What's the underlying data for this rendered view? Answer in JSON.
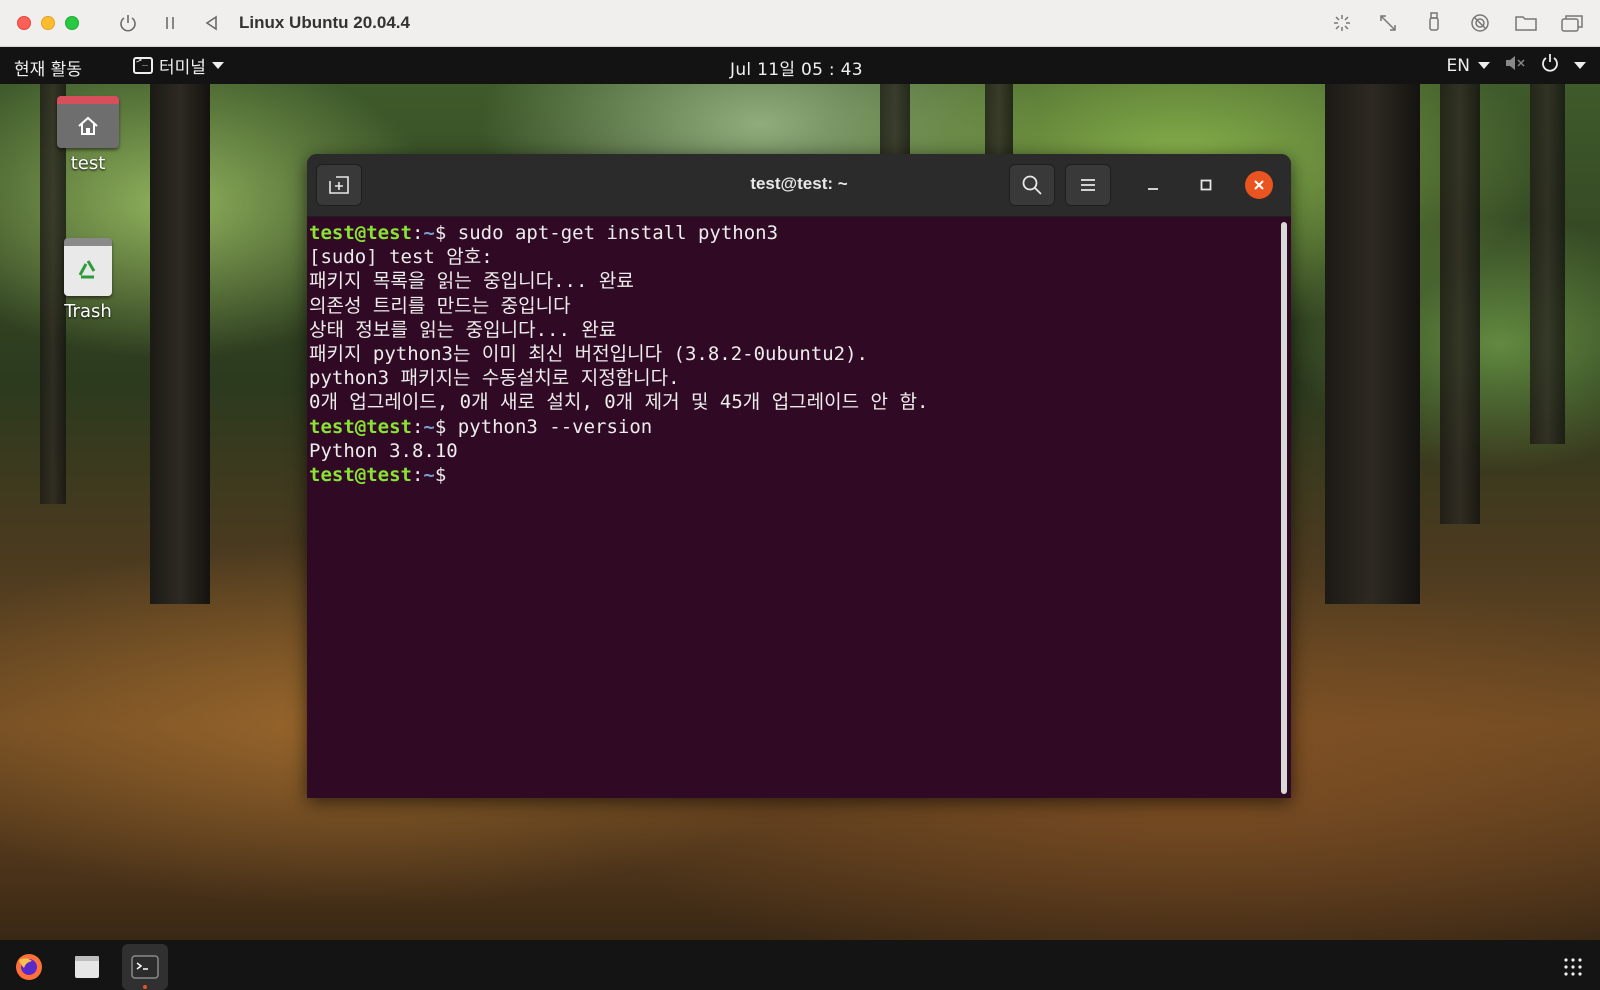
{
  "vm": {
    "title": "Linux Ubuntu 20.04.4",
    "left_controls": [
      "power-icon",
      "pause-icon",
      "back-icon"
    ],
    "right_controls": [
      "brightness-icon",
      "resize-icon",
      "usb-icon",
      "sharing-icon",
      "folder-icon",
      "windows-icon"
    ]
  },
  "topbar": {
    "activities": "현재 활동",
    "app_name": "터미널",
    "clock": "Jul 11일  05 : 43",
    "lang": "EN"
  },
  "desktop": {
    "icons": [
      {
        "label": "test",
        "icon": "home-folder-icon"
      },
      {
        "label": "Trash",
        "icon": "trash-icon"
      }
    ]
  },
  "terminal": {
    "title": "test@test: ~",
    "prompt": {
      "user": "test@test",
      "sep": ":",
      "path": "~",
      "symbol": "$"
    },
    "lines": [
      {
        "type": "prompt",
        "text": " sudo apt-get install python3"
      },
      {
        "type": "output",
        "text": "[sudo] test 암호:"
      },
      {
        "type": "output",
        "text": "패키지 목록을 읽는 중입니다... 완료"
      },
      {
        "type": "output",
        "text": "의존성 트리를 만드는 중입니다"
      },
      {
        "type": "output",
        "text": "상태 정보를 읽는 중입니다... 완료"
      },
      {
        "type": "output",
        "text": "패키지 python3는 이미 최신 버전입니다 (3.8.2-0ubuntu2)."
      },
      {
        "type": "output",
        "text": "python3 패키지는 수동설치로 지정합니다."
      },
      {
        "type": "output",
        "text": "0개 업그레이드, 0개 새로 설치, 0개 제거 및 45개 업그레이드 안 함."
      },
      {
        "type": "prompt",
        "text": " python3 --version"
      },
      {
        "type": "output",
        "text": "Python 3.8.10"
      },
      {
        "type": "prompt",
        "text": ""
      }
    ]
  },
  "dock": {
    "items": [
      "firefox-icon",
      "files-icon",
      "terminal-icon"
    ],
    "apps_grid": "apps-grid-icon"
  },
  "colors": {
    "terminal_bg": "#300a24",
    "prompt_user": "#8ae234",
    "prompt_path": "#729fcf",
    "ubuntu_orange": "#e95420"
  }
}
